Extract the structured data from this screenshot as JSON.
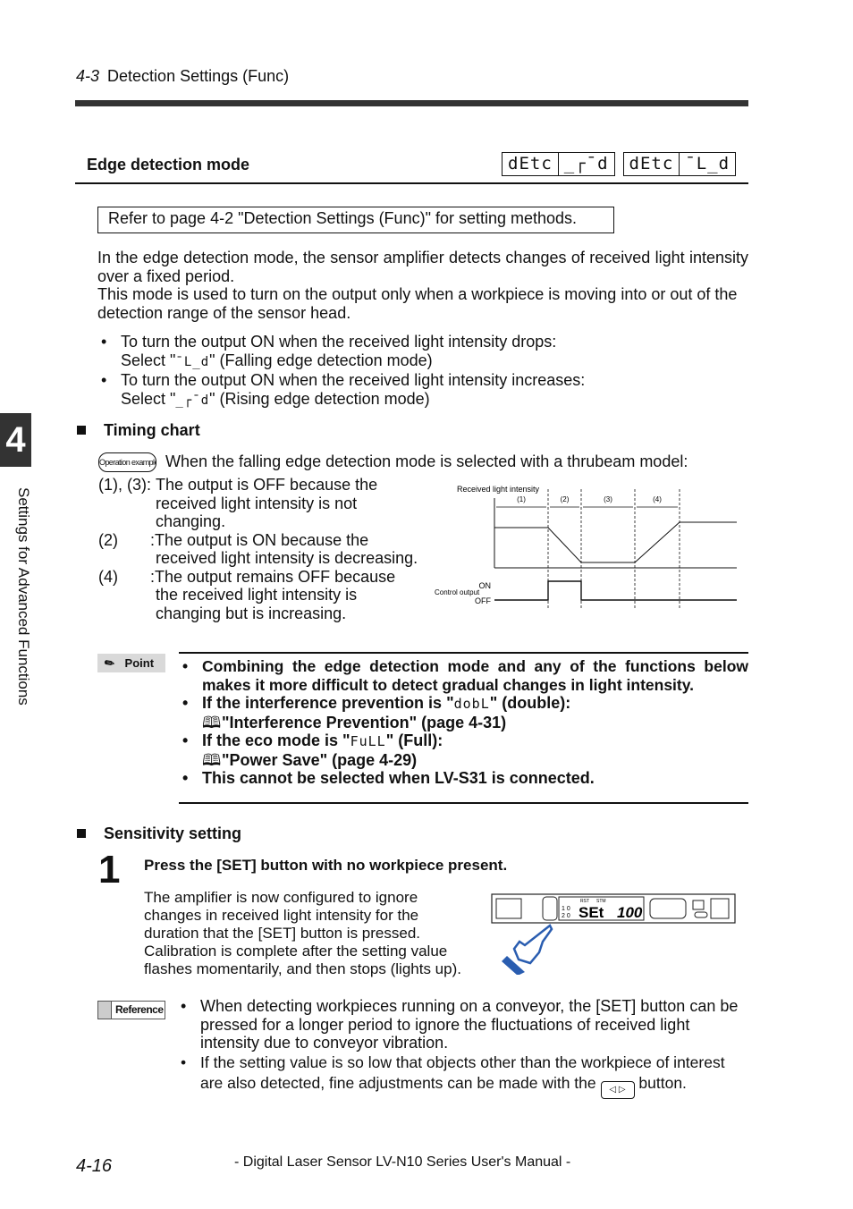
{
  "header": {
    "section_number": "4-3",
    "section_title": "Detection Settings (Func)"
  },
  "side_tab": {
    "chapter_number": "4",
    "chapter_title": "Settings for Advanced Functions"
  },
  "edge_mode": {
    "title": "Edge detection mode",
    "lcd_displays": [
      {
        "left": "dEtc",
        "right": "_┌¯d"
      },
      {
        "left": "dEtc",
        "right": "¯L_d"
      }
    ],
    "refer_box": "Refer to page 4-2 \"Detection Settings (Func)\" for setting methods.",
    "intro_1": "In the edge detection mode, the sensor amplifier detects changes of received light intensity over a fixed period.",
    "intro_2": "This mode is used to turn on the output only when a workpiece is moving into or out of the detection range of the sensor head.",
    "bullets": [
      {
        "line1": "To turn the output ON when the received light intensity drops:",
        "pre": "Select \"",
        "code": "¯L_d",
        "post": "\" (Falling edge detection mode)"
      },
      {
        "line1": "To turn the output ON when the received light intensity increases:",
        "pre": "Select \"",
        "code": "_┌¯d",
        "post": "\" (Rising edge detection mode)"
      }
    ]
  },
  "timing_chart": {
    "heading": "Timing chart",
    "operation_badge": "Operation example",
    "operation_text": "When the falling edge detection mode is selected with a thrubeam model:",
    "explanations": [
      {
        "label": "(1), (3):",
        "text": "The output is OFF because the received light intensity is not changing."
      },
      {
        "label": "(2)",
        "text": ":The output is ON because the received light intensity is decreasing."
      },
      {
        "label": "(4)",
        "text": ":The output remains OFF because the received light intensity is changing but is increasing."
      }
    ]
  },
  "chart_data": {
    "type": "line",
    "title": "",
    "ylabel": "Received light intensity",
    "phases": [
      "(1)",
      "(2)",
      "(3)",
      "(4)"
    ],
    "x": [
      0,
      1,
      2,
      3,
      4,
      5
    ],
    "series": [
      {
        "name": "Received light intensity",
        "values": [
          0.75,
          0.75,
          0.1,
          0.1,
          0.85,
          0.85
        ]
      },
      {
        "name": "Control output",
        "values": [
          "OFF",
          "ON",
          "OFF",
          "OFF",
          "OFF",
          "OFF"
        ]
      }
    ],
    "phase_boundaries": [
      1,
      2,
      3,
      4
    ],
    "control_output_label": "Control output",
    "on_label": "ON",
    "off_label": "OFF"
  },
  "point": {
    "badge": "Point",
    "items": [
      "Combining the edge detection mode and any of the functions below makes it more difficult to detect gradual changes in light intensity."
    ],
    "interference": {
      "pre": "If the interference prevention is \"",
      "code": "dobL",
      "post": "\" (double):",
      "ref": "\"Interference Prevention\" (page 4-31)"
    },
    "eco": {
      "pre": "If the eco mode is \"",
      "code": "FuLL",
      "post": "\" (Full):",
      "ref": "\"Power Save\" (page 4-29)"
    },
    "last": "This cannot be selected when LV-S31 is connected."
  },
  "sensitivity": {
    "heading": "Sensitivity setting",
    "step_number": "1",
    "step_title": "Press the [SET] button with no workpiece present.",
    "step_body": "The amplifier is now configured to ignore changes in received light intensity for the duration that the [SET] button is pressed. Calibration is complete after the setting value flashes momentarily, and then stops (lights up).",
    "device_display": {
      "left": "SEt",
      "right": "100",
      "labels": [
        "RST",
        "STM"
      ]
    }
  },
  "reference": {
    "badge": "Reference",
    "bullets": [
      "When detecting workpieces running on a conveyor, the [SET] button can be pressed for a longer period to ignore the fluctuations of received light intensity due to conveyor vibration.",
      {
        "pre": "If the setting value is so low that objects other than the workpiece of interest are also detected, fine adjustments can be made with the",
        "post": "button."
      }
    ]
  },
  "footer": {
    "page_number": "4-16",
    "manual_title": "- Digital Laser Sensor LV-N10 Series User's Manual -"
  }
}
